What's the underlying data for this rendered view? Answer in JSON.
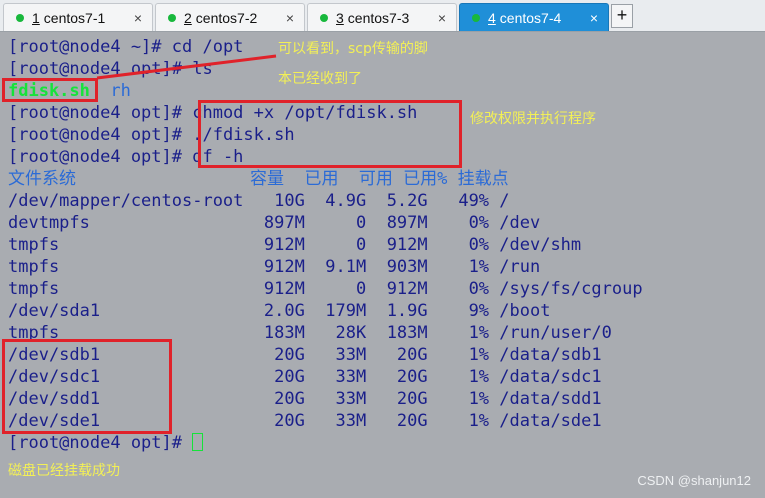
{
  "tabs": [
    {
      "num": "1",
      "label": "centos7-1",
      "close": "×"
    },
    {
      "num": "2",
      "label": "centos7-2",
      "close": "×"
    },
    {
      "num": "3",
      "label": "centos7-3",
      "close": "×"
    },
    {
      "num": "4",
      "label": "centos7-4",
      "close": "×"
    }
  ],
  "tab_add": "+",
  "terminal": {
    "l1": {
      "prompt": "[root@node4 ~]# ",
      "cmd": "cd /opt"
    },
    "l2": {
      "prompt": "[root@node4 opt]# ",
      "cmd": "ls"
    },
    "l3": {
      "file": "fdisk.sh",
      "dir": "rh"
    },
    "l4": {
      "prompt": "[root@node4 opt]# ",
      "cmd": "chmod +x /opt/fdisk.sh"
    },
    "l5": {
      "prompt": "[root@node4 opt]# ",
      "cmd": "./fdisk.sh"
    },
    "l6": {
      "prompt": "[root@node4 opt]# ",
      "cmd": "df -h"
    },
    "df_header": "文件系统                 容量  已用  可用 已用% 挂载点",
    "df_rows": [
      "/dev/mapper/centos-root   10G  4.9G  5.2G   49% /",
      "devtmpfs                 897M     0  897M    0% /dev",
      "tmpfs                    912M     0  912M    0% /dev/shm",
      "tmpfs                    912M  9.1M  903M    1% /run",
      "tmpfs                    912M     0  912M    0% /sys/fs/cgroup",
      "/dev/sda1                2.0G  179M  1.9G    9% /boot",
      "tmpfs                    183M   28K  183M    1% /run/user/0",
      "/dev/sdb1                 20G   33M   20G    1% /data/sdb1",
      "/dev/sdc1                 20G   33M   20G    1% /data/sdc1",
      "/dev/sdd1                 20G   33M   20G    1% /data/sdd1",
      "/dev/sde1                 20G   33M   20G    1% /data/sde1"
    ],
    "last_prompt": "[root@node4 opt]# "
  },
  "annotations": {
    "scp_note_1": "可以看到，scp传输的脚",
    "scp_note_2": "本已经收到了",
    "exec_note": "修改权限并执行程序",
    "mount_note": "磁盘已经挂载成功"
  },
  "watermark": "CSDN @shanjun12",
  "colors": {
    "terminal_bg": "#a9acb1",
    "prompt": "#1a1f8a",
    "executable": "#16e33a",
    "directory": "#2b6bd6",
    "annotation": "#f3f056",
    "highlight_box": "#e0222a",
    "active_tab": "#1f8fd8"
  }
}
